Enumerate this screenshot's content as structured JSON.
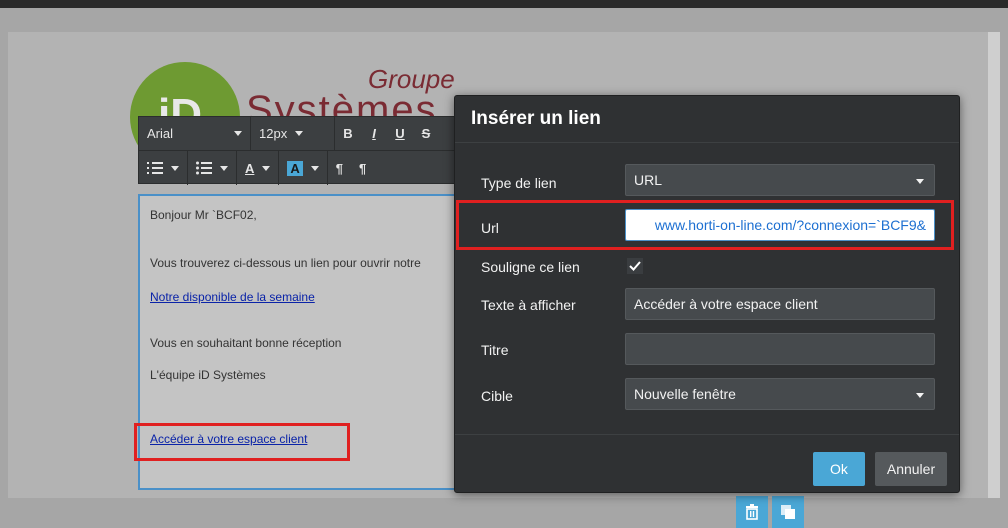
{
  "logo": {
    "mark": "iD",
    "groupe": "Groupe",
    "systemes": "Systèmes"
  },
  "toolbar": {
    "font_family": "Arial",
    "font_size": "12px",
    "bold": "B",
    "italic": "I",
    "underline": "U",
    "strike": "S",
    "ordered_list_icon": "ordered-list-icon",
    "unordered_list_icon": "unordered-list-icon",
    "text_color_label": "A",
    "bg_color_label": "A",
    "ltr_icon": "paragraph-ltr-icon",
    "rtl_icon": "paragraph-rtl-icon"
  },
  "email": {
    "greeting": "Bonjour Mr `BCF02,",
    "intro": "Vous trouverez ci-dessous un lien pour ouvrir notre",
    "link_weekly": "Notre disponible de la semaine",
    "closing": "Vous en souhaitant bonne réception",
    "signature": "L'équipe iD Systèmes",
    "link_client": "Accéder à votre espace client"
  },
  "modal": {
    "title": "Insérer un lien",
    "link_type_label": "Type de lien",
    "link_type_value": "URL",
    "url_label": "Url",
    "url_value": "www.horti-on-line.com/?connexion=`BCF9&",
    "underline_label": "Souligne ce lien",
    "underline_checked": true,
    "display_text_label": "Texte à afficher",
    "display_text_value": "Accéder à votre espace client",
    "title_label": "Titre",
    "title_value": "",
    "target_label": "Cible",
    "target_value": "Nouvelle fenêtre",
    "ok_label": "Ok",
    "cancel_label": "Annuler"
  },
  "float_buttons": {
    "delete_icon": "trash-icon",
    "copy_icon": "copy-icon"
  },
  "colors": {
    "accent": "#4aa7d6",
    "highlight": "#e02020",
    "modal_bg": "#2f3133",
    "link": "#0a23a8"
  }
}
